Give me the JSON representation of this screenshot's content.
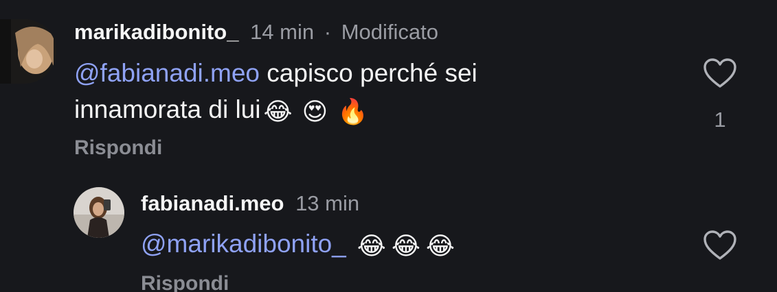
{
  "comments": [
    {
      "username": "marikadibonito_",
      "time": "14 min",
      "separator": "·",
      "edited": "Modificato",
      "mention": "@fabianadi.meo",
      "text_line1": " capisco perché sei",
      "text_line2": "innamorata di lui",
      "emojis": [
        "😂",
        "😍",
        "🔥"
      ],
      "reply_label": "Rispondi",
      "like_icon": "heart-outline-icon",
      "like_count": "1"
    },
    {
      "username": "fabianadi.meo",
      "time": "13 min",
      "mention": "@marikadibonito_",
      "emojis": [
        "😂",
        "😂",
        "😂"
      ],
      "reply_label": "Rispondi",
      "like_icon": "heart-outline-icon"
    }
  ],
  "colors": {
    "background": "#17181c",
    "mention": "#8fa2f5",
    "meta": "#9a9ca3"
  }
}
